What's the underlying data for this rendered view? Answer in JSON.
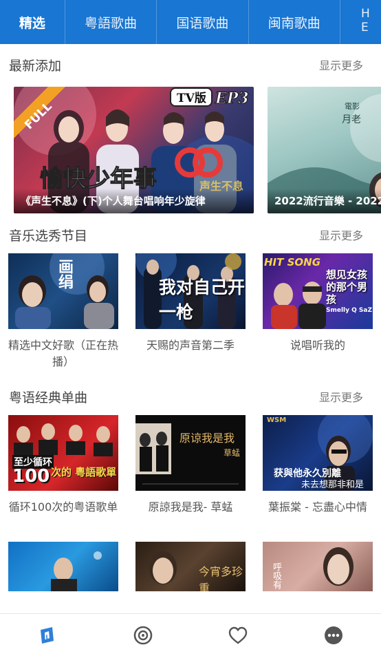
{
  "tabs": [
    {
      "label": "精选",
      "active": true
    },
    {
      "label": "粤語歌曲"
    },
    {
      "label": "国语歌曲"
    },
    {
      "label": "闽南歌曲"
    },
    {
      "label": "H",
      "label2": "E"
    }
  ],
  "sections": {
    "latest": {
      "title": "最新添加",
      "more": "显示更多"
    },
    "shows": {
      "title": "音乐选秀节目",
      "more": "显示更多"
    },
    "cantonese": {
      "title": "粤语经典单曲",
      "more": "显示更多"
    }
  },
  "featured": [
    {
      "caption": "《声生不息》(下)个人舞台唱响年少旋律",
      "badge_tv": "TV版",
      "badge_ep": "EP3",
      "ribbon": "FULL",
      "overlay": "愉快少年事"
    },
    {
      "caption": "2022流行音樂 - 2022",
      "overlay_title": "月老",
      "overlay_top": "電影"
    }
  ],
  "shows": [
    {
      "title": "精选中文好歌（正在热播）",
      "thumb_text": "画绢"
    },
    {
      "title": "天赐的声音第二季",
      "thumb_text": "我对自己开一枪"
    },
    {
      "title": "说唱听我的",
      "thumb_text": "HIT SONG",
      "thumb_text2": "想见女孩的那个男孩",
      "thumb_text3": "Smelly Q SaZ"
    }
  ],
  "cantonese": [
    {
      "title": "循环100次的粤语歌单",
      "thumb_text": "至少循环",
      "thumb_num": "100",
      "thumb_text2": "次的 粵語歌單"
    },
    {
      "title": "原諒我是我- 草蜢",
      "thumb_text": "原谅我是我",
      "thumb_sub": "草蜢"
    },
    {
      "title": "葉振棠 - 忘盡心中情",
      "thumb_text": "获與他永久別離",
      "thumb_text2": "未去想那非和是",
      "thumb_logo": "WSM"
    }
  ],
  "more_row": [
    {
      "thumb_text": ""
    },
    {
      "thumb_text": "今宵多珍重"
    },
    {
      "thumb_text": "呼吸有"
    }
  ],
  "nav": [
    {
      "icon": "home-icon",
      "active": true
    },
    {
      "icon": "vinyl-icon"
    },
    {
      "icon": "heart-icon"
    },
    {
      "icon": "more-icon"
    }
  ],
  "colors": {
    "accent": "#1976d2",
    "nav_active": "#2f7fd8",
    "nav_inactive": "#555555"
  }
}
